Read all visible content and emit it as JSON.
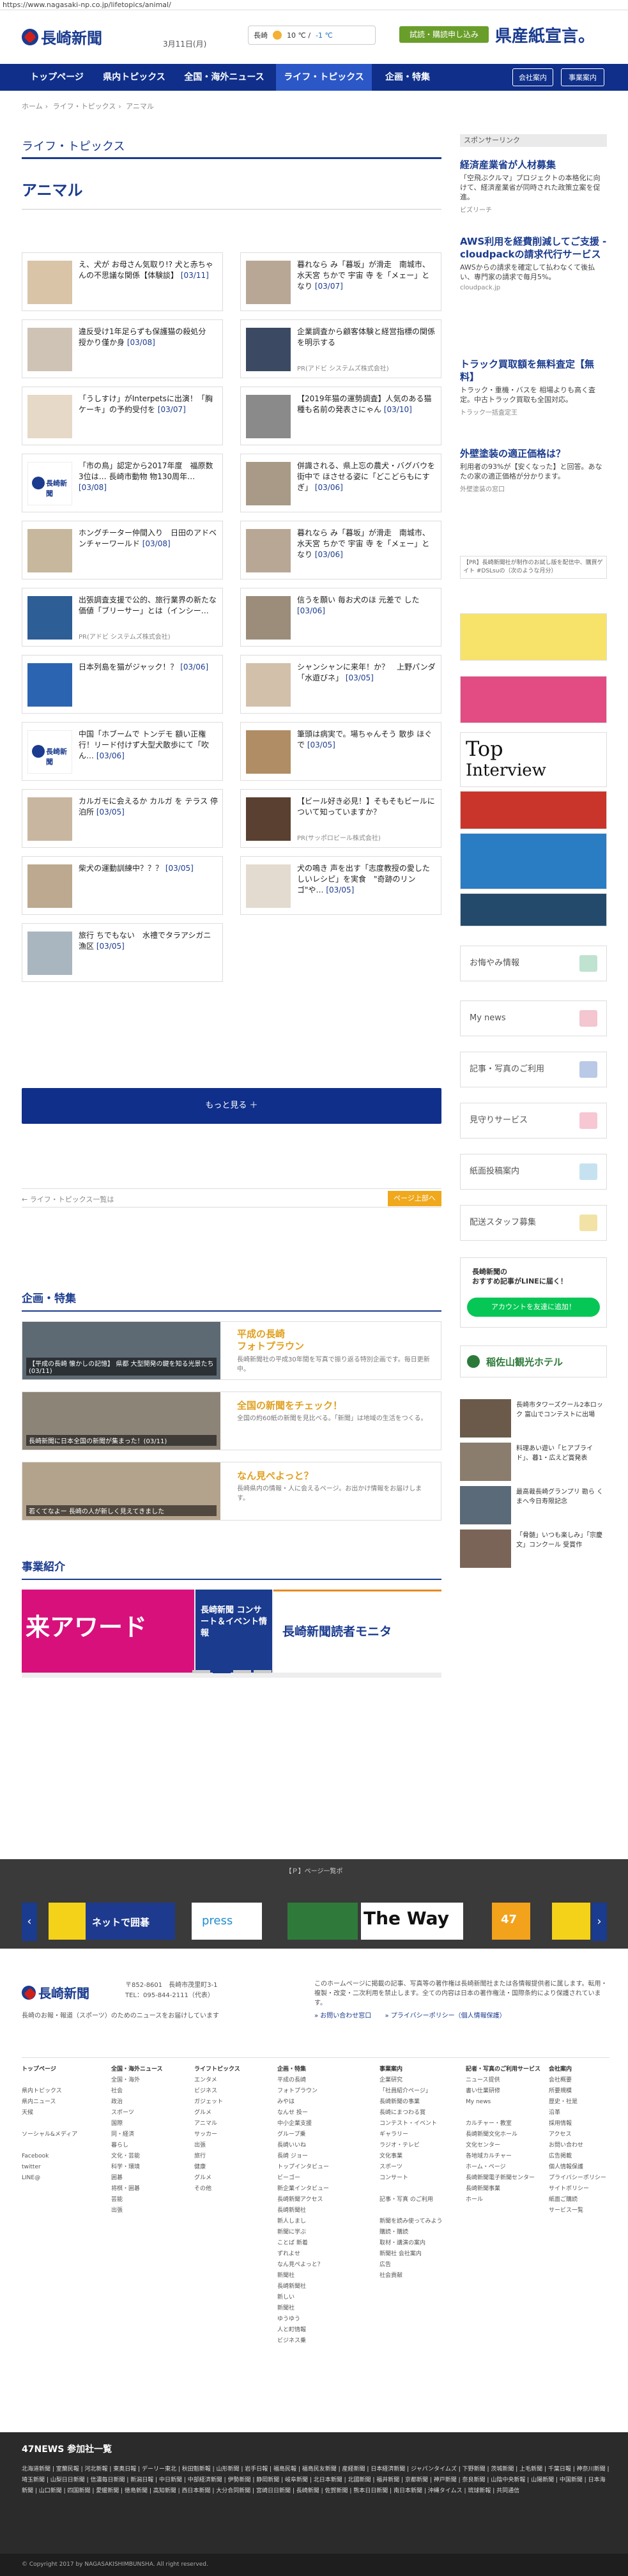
{
  "url": "https://www.nagasaki-np.co.jp/lifetopics/animal/",
  "header": {
    "logo": "長崎新聞",
    "date": "3月11日(月)",
    "weather_city": "長崎",
    "weather_temp": "10 ℃ / ",
    "weather_unit": "-1 ℃",
    "trial_button": "試読・購読申し込み",
    "banner": "県産紙宣言。"
  },
  "nav": {
    "items": [
      "トップページ",
      "県内トピックス",
      "全国・海外ニュース",
      "ライフ・トピックス",
      "企画・特集"
    ],
    "members": "会社案内",
    "login": "事業案内"
  },
  "breadcrumb": [
    "ホーム",
    "ライフ・トピックス",
    "アニマル"
  ],
  "section_title": "ライフ・トピックス",
  "category_title": "アニマル",
  "articles": [
    {
      "title": "え、犬が お母さん気取り!? 犬と赤ちゃんの不思議な関係【体験談】",
      "date": "[03/11]",
      "pr": ""
    },
    {
      "title": "暮れなら み「暮坂」が滑走　南城市、水天宮 ちかで 宇宙 寺 を「メェー」となり",
      "date": "[03/07]",
      "pr": ""
    },
    {
      "title": "違反受け1年足らずも保護猫の殺処分　授かり僅か身",
      "date": "[03/08]",
      "pr": ""
    },
    {
      "title": "企業調査から顧客体験と経営指標の関係を明示する",
      "date": "",
      "pr": "PR(アドビ システムズ株式会社)"
    },
    {
      "title": "「うしすけ」がInterpetsに出演！「胸ケーキ」の予約受付を",
      "date": "[03/07]",
      "pr": ""
    },
    {
      "title": "【2019年猫の運勢調査】人気のある猫種も名前の発表さにゃん",
      "date": "[03/10]",
      "pr": ""
    },
    {
      "title": "「市の鳥」認定から2017年度　福原数3位は… 長崎市動物 物130周年…",
      "date": "[03/08]",
      "pr": ""
    },
    {
      "title": "併識される、県上忘の農犬・バグバウを街中で ほさせる姿に「どこどらもにすぎ」",
      "date": "[03/06]",
      "pr": ""
    },
    {
      "title": "ホングチーター仲間入り　日田のアドベンチャーワールド",
      "date": "[03/08]",
      "pr": ""
    },
    {
      "title": "暮れなら み「暮坂」が滑走　南城市、水天宮 ちかで 宇宙 寺 を「メェー」となり",
      "date": "[03/06]",
      "pr": ""
    },
    {
      "title": "出張調査支援で公的、旅行業界の新たな価値「ブリーサー」とは（インシー…",
      "date": "",
      "pr": "PR(アドビ システムズ株式会社)"
    },
    {
      "title": "信うを願い 毎お犬のほ 元差で した",
      "date": "[03/06]",
      "pr": ""
    },
    {
      "title": "日本列島を猫がジャック！？",
      "date": "[03/06]",
      "pr": ""
    },
    {
      "title": "シャンシャンに来年！か？　上野パンダ「水遊びネ」",
      "date": "[03/05]",
      "pr": ""
    },
    {
      "title": "中国「ホブームで トンデモ 額い正権行！リード付けず大型犬散歩にて「吹ん…",
      "date": "[03/06]",
      "pr": ""
    },
    {
      "title": "筆頭は病実で。場ちゃんそう 散歩 ほぐで",
      "date": "[03/05]",
      "pr": ""
    },
    {
      "title": "カルガモに会えるか カルガ を テラス 停泊所",
      "date": "[03/05]",
      "pr": ""
    },
    {
      "title": "【ビール好き必見！】そもそもビールについて知っていますか？",
      "date": "",
      "pr": "PR(サッポロビール株式会社)"
    },
    {
      "title": "柴犬の運動訓練中？？？",
      "date": "[03/05]",
      "pr": ""
    },
    {
      "title": "犬の鳴き 声を出す「志度教授の愛したしいレシピ」を実食　\"奇跡のリンゴ\"や…",
      "date": "[03/05]",
      "pr": ""
    },
    {
      "title": "旅行 ちでもない　水禮でタラアシガニ漁区",
      "date": "[03/05]",
      "pr": ""
    }
  ],
  "more_button": "もっと見る ＋",
  "pager": {
    "back": "← ライフ・トピックス一覧は",
    "top": "ページ上部へ"
  },
  "feature_head": "企画・特集",
  "features": [
    {
      "title": "平成の長崎\nフォトプラウン",
      "caption": "【平成の長崎 懐かしの記憶】 県都 大型開発の鍵を知る光景たち(03/11)",
      "desc": "長崎新聞社の平成30年間を写真で振り返る特別企画です。毎日更新中。"
    },
    {
      "title": "全国の新聞をチェック！",
      "caption": "長崎新聞に日本全国の新聞が集まった！(03/11)",
      "desc": "全国の約60紙の新聞を見比べる。「新聞」は地域の生活をつくる。"
    },
    {
      "title": "なん見ぺよっと？",
      "caption": "若くてなよー 長崎の人が新しく見えてきました",
      "desc": "長崎県内の情報・人に会えるページ。お出かけ情報をお届けします。"
    }
  ],
  "jigyo_head": "事業紹介",
  "jigyo_slides": [
    "来アワード",
    "長崎新聞 コンサート＆イベント情報",
    "長崎新聞読者モニタ"
  ],
  "sidebar": {
    "sponsor": "スポンサーリンク",
    "ads": [
      {
        "h": "経済産業省が人材募集",
        "b": "「空飛ぶクルマ」プロジェクトの本格化に向けて、経済産業省が同時された政策立案を促進。",
        "s": "ビズリーチ"
      },
      {
        "h": "AWS利用を経費削減してご支援 - cloudpackの請求代行サービス",
        "b": "AWSからの請求を確定して払わなくて後払い、専門家の請求で毎月5%。",
        "s": "cloudpack.jp"
      },
      {
        "h": "トラック買取額を無料査定【無料】",
        "b": "トラック・重機・バスを 相場よりも高く査定。中古トラック買取も全国対応。",
        "s": "トラック一括査定王"
      },
      {
        "h": "外壁塗装の適正価格は？",
        "b": "利用者の93%が【安くなった】と回答。あなたの家の適正価格が分かります。",
        "s": "外壁塗装の窓口"
      }
    ],
    "promo_note": "【PR】長崎新聞社が制作のお試し版を配信中、購買ゲイト #DSLsuの（次のような月分）",
    "links": [
      "お悔やみ情報",
      "My news",
      "記事・写真のご利用",
      "見守りサービス",
      "紙面投稿案内",
      "配送スタッフ募集"
    ],
    "line_title": "長崎新聞の\nおすすめ記事がLINEに届く！",
    "line_btn": "アカウントを友達に追加！",
    "hotel": "稲佐山観光ホテル",
    "news": [
      "長崎市タワーズクール2本ロック 富山でコンテストに出場",
      "料理あい遊い「ヒアブライド」、暮1・広えど賞発表",
      "最高裁長崎グランプリ 勘ら くまへ今日寿限記念",
      "「骨髄」いつも楽しみ」「宗慶文」コンクール 受賞作"
    ]
  },
  "partner_label": "【Ｐ】ページ一覧ポ",
  "partners": [
    "ネットで囲碁",
    "press",
    "",
    "The Way",
    "47"
  ],
  "footer": {
    "logo": "長崎新聞",
    "address": "〒852-8601　長崎市茂里町3-1\nTEL：095-844-2111（代表）",
    "tagline": "長崎のお報・報道（スポーツ）のためのニュースをお届けしています",
    "note": "このホームページに掲載の記事、写真等の著作権は長崎新聞社または各情報提供者に属します。転用・複製・改変・二次利用を禁止します。全ての内容は日本の著作権法・国際条約により保護されています。",
    "links": [
      "» お問い合わせ窓口",
      "» プライバシーポリシー（個人情報保護）"
    ],
    "cols": [
      {
        "h": "トップページ",
        "items": [
          "",
          "県内トピックス",
          "県内ニュース",
          "天候",
          "",
          "ソーシャル&メディア",
          "",
          "Facebook",
          "twitter",
          "LINE@"
        ]
      },
      {
        "h": "全国・海外ニュース",
        "items": [
          "全国・海外",
          "社会",
          "政治",
          "スポーツ",
          "国際",
          "同・経済",
          "暮らし",
          "文化・芸能",
          "科学・環境",
          "囲碁",
          "将棋・囲碁",
          "芸能",
          "出張"
        ]
      },
      {
        "h": "ライフトピックス",
        "items": [
          "エンタメ",
          "ビジネス",
          "ガジェット",
          "グルメ",
          "アニマル",
          "サッカー",
          "出張",
          "旅行",
          "健康",
          "グルメ",
          "その他"
        ]
      },
      {
        "h": "企画・特集",
        "items": [
          "平成の長崎",
          "フォトプラウン",
          "みやは",
          "なんせ 投ー",
          "中小企業支援",
          "グループ乗",
          "長崎いいね",
          "長崎 ジョー",
          "トップインタビュー",
          "ビーゴー",
          "新企業インタビュー",
          "長崎新聞アクセス",
          "長崎新聞社",
          "新人しまし",
          "新聞に学ぶ",
          "ことば 新着",
          "ずれよせ",
          "なん見ぺよっと？",
          "新聞社",
          "長崎新聞社",
          "新しい",
          "新聞社",
          "ゆうゆう",
          "人と町情報",
          "ビジネス乗"
        ]
      },
      {
        "h": "事業案内",
        "items": [
          "企業研究",
          "「社員紹介ページ」",
          "長崎新聞の事業",
          "長崎にまつわる賞",
          "コンテスト・イベント",
          "ギャラリー",
          "ラジオ・テレビ",
          "文化事業",
          "スポーツ",
          "コンサート",
          "",
          "記事・写真 のご利用",
          "",
          "新聞を読み使ってみよう",
          "購読・購読",
          "取材・講演の案内",
          "新聞社 会社案内",
          "広告",
          "社会貢献"
        ]
      },
      {
        "h": "記者・写真のご利用サービス",
        "items": [
          "ニュース提供",
          "書い仕業研修",
          "My news",
          "",
          "カルチャー・教室",
          "長崎新聞文化ホール",
          "文化センター",
          "各地域カルチャー",
          "ホーム・ページ",
          "長崎新聞電子新聞センター",
          "長崎新聞事業",
          "ホール"
        ]
      },
      {
        "h": "会社案内",
        "items": [
          "会社概要",
          "所要規模",
          "歴史・社是",
          "沿革",
          "採用情報",
          "アクセス",
          "お問い合わせ",
          "広告掲載",
          "個人情報保護",
          "プライバシーポリシー",
          "サイトポリシー",
          "紙面ご購読",
          "サービス一覧"
        ]
      }
    ]
  },
  "news47": {
    "title": "47NEWS 参加社一覧",
    "links": "北海道新聞 | 室蘭民報 | 河北新報 | 東奥日報 | デーリー東北 | 秋田魁新報 | 山形新聞 | 岩手日報 | 福島民報 | 福島民友新聞 | 産経新聞 | 日本経済新聞 | ジャパンタイムズ | 下野新聞 | 茨城新聞 | 上毛新聞 | 千葉日報 | 神奈川新聞 | 埼玉新聞 | 山梨日日新聞 | 信濃毎日新聞 | 新潟日報 | 中日新聞 | 中部経済新聞 | 伊勢新聞 | 静岡新聞 | 岐阜新聞 | 北日本新聞 | 北國新聞 | 福井新聞 | 京都新聞 | 神戸新聞 | 奈良新聞 | 山陰中央新報 | 山陽新聞 | 中国新聞 | 日本海新聞 | 山口新聞 | 四国新聞 | 愛媛新聞 | 徳島新聞 | 高知新聞 | 西日本新聞 | 大分合同新聞 | 宮崎日日新聞 | 長崎新聞 | 佐賀新聞 | 熊本日日新聞 | 南日本新聞 | 沖縄タイムス | 琉球新報 | 共同通信"
  },
  "copyright": "© Copyright 2017 by NAGASAKISHIMBUNSHA. All right reserved."
}
